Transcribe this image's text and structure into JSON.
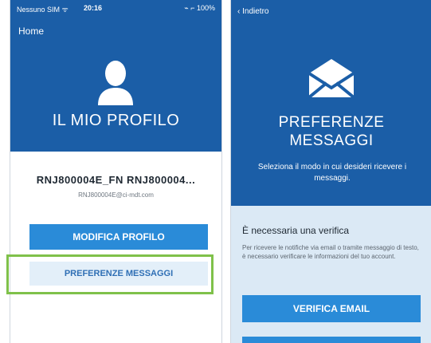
{
  "left_screen": {
    "status": {
      "carrier": "Nessuno SIM ᯤ",
      "time": "20:16",
      "battery": "⌁ ⌐ 100%"
    },
    "nav": {
      "home_label": "Home"
    },
    "profile_title": "IL MIO PROFILO",
    "user_name": "RNJ800004E_FN RNJ800004...",
    "user_email": "RNJ800004E@ci-mdt.com",
    "modifica_label": "MODIFICA PROFILO",
    "preferenze_label": "PREFERENZE MESSAGGI"
  },
  "right_screen": {
    "back_label": "Indietro",
    "title_line1": "PREFERENZE",
    "title_line2": "MESSAGGI",
    "subtitle": "Seleziona il modo in cui desideri ricevere i messaggi.",
    "verify_heading": "È necessaria una verifica",
    "verify_text": "Per ricevere le notifiche via email o tramite messaggio di testo, è necessario verificare le informazioni del tuo account.",
    "verifica_label": "VERIFICA EMAIL"
  },
  "colors": {
    "brand_blue": "#1b5ea7",
    "button_blue": "#2a8bd8",
    "highlight_green": "#7fc14a"
  },
  "icons": [
    "user-icon",
    "envelope-icon",
    "chevron-left-icon"
  ]
}
